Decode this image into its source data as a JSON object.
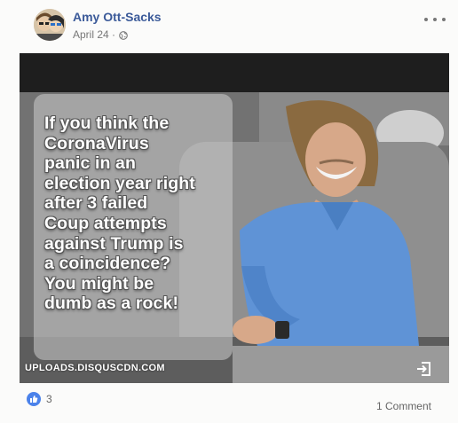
{
  "post": {
    "author": "Amy Ott-Sacks",
    "date": "April 24 ·",
    "privacy_icon": "globe-icon",
    "menu_icon": "more-options-icon"
  },
  "image": {
    "meme_text_lines": [
      "If you think the",
      "CoronaVirus",
      "panic in an",
      "election year right",
      "after 3 failed",
      "Coup attempts",
      "against Trump is",
      "a coincidence?",
      "You might be",
      "dumb as a rock!"
    ],
    "watermark": "UPLOADS.DISQUSCDN.COM",
    "share_icon": "external-link-icon"
  },
  "footer": {
    "like_count": "3",
    "comments_label": "1 Comment",
    "like_icon": "thumbs-up-icon"
  },
  "colors": {
    "author_link": "#3b5a99",
    "like_badge": "#4b82ea",
    "shirt": "#5f93d6"
  }
}
